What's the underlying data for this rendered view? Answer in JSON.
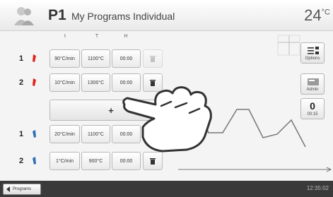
{
  "header": {
    "program_number": "P1",
    "program_name": "My Programs Individual",
    "temperature": "24",
    "temperature_unit": "°C"
  },
  "columns": [
    "t",
    "T",
    "H"
  ],
  "rows_heating": [
    {
      "index": "1",
      "rate": "90°C/min",
      "temp": "1100°C",
      "hold": "00:00",
      "delete_enabled": false
    },
    {
      "index": "2",
      "rate": "10°C/min",
      "temp": "1300°C",
      "hold": "00:00",
      "delete_enabled": true
    }
  ],
  "add_label": "+",
  "rows_cooling": [
    {
      "index": "1",
      "rate": "20°C/min",
      "temp": "1100°C",
      "hold": "00:00"
    },
    {
      "index": "2",
      "rate": "1°C/min",
      "temp": "900°C",
      "hold": "00:00"
    }
  ],
  "side": {
    "options_label": "Options",
    "admin_label": "Admin",
    "counter_value": "0",
    "counter_time": "00:15"
  },
  "footer": {
    "programs_label": "Programs",
    "time": "12:35:02"
  },
  "colors": {
    "heat_pin": "#e0241b",
    "cool_pin": "#2f6fb5"
  }
}
